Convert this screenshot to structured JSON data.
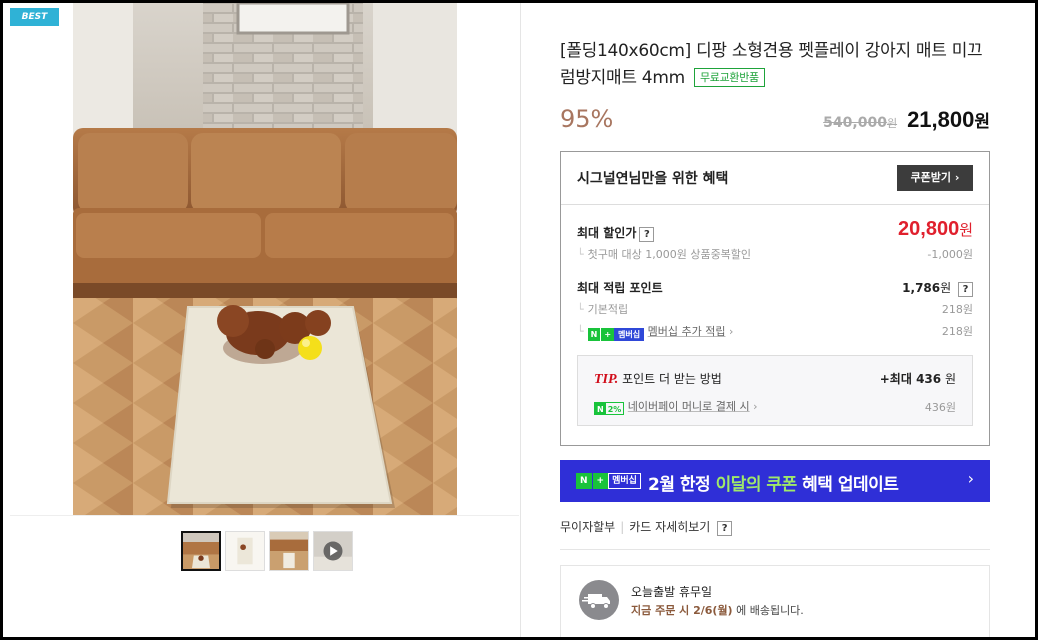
{
  "gallery": {
    "badge": "BEST",
    "thumbnails": [
      "thumb-1",
      "thumb-2",
      "thumb-3",
      "thumb-video"
    ]
  },
  "product": {
    "title": "[폴딩140x60cm] 디팡 소형견용 펫플레이 강아지 매트 미끄럼방지매트 4mm",
    "exchange_badge": "무료교환반품",
    "discount_rate": "95%",
    "original_price": "540,000",
    "original_currency": "원",
    "sale_price": "21,800",
    "sale_currency": "원"
  },
  "benefit": {
    "title": "시그널연님만을 위한 혜택",
    "coupon_button": "쿠폰받기",
    "max_discount_label": "최대 할인가",
    "max_discount_price": "20,800",
    "max_discount_currency": "원",
    "first_purchase_label": "첫구매 대상 1,000원 상품중복할인",
    "first_purchase_value": "-1,000원",
    "max_points_label": "최대 적립 포인트",
    "max_points_value": "1,786",
    "max_points_unit": "원",
    "basic_points_label": "기본적립",
    "basic_points_value": "218원",
    "membership_points_label": "멤버십 추가 적립",
    "membership_points_value": "218원",
    "npay_mark_n": "N",
    "npay_mark_plus": "+",
    "npay_mark_member": "멤버십",
    "tip_label": "TIP.",
    "tip_text": "포인트 더 받는 방법",
    "tip_max": "+최대 436",
    "tip_max_unit": "원",
    "npay_money_badge_n": "N",
    "npay_money_badge_pct": "2%",
    "npay_money_label": "네이버페이 머니로 결제 시",
    "npay_money_value": "436원",
    "help_glyph": "?"
  },
  "promo": {
    "mark_n": "N",
    "mark_plus": "+",
    "mark_member": "멤버십",
    "text_prefix": "2월 한정 ",
    "text_highlight": "이달의 쿠폰",
    "text_suffix": " 혜택 업데이트",
    "arrow": "›"
  },
  "payment": {
    "installment": "무이자할부",
    "card_detail": "카드 자세히보기"
  },
  "delivery": {
    "title": "오늘출발 휴무일",
    "sub_highlight": "지금 주문 시 2/6(월)",
    "sub_rest": " 에 배송됩니다."
  },
  "colors": {
    "accent_red": "#e0202d",
    "discount_brown": "#a87660",
    "npay_green": "#19c33b",
    "banner_blue": "#2f2fd7",
    "badge_blue": "#2fb2d6"
  }
}
